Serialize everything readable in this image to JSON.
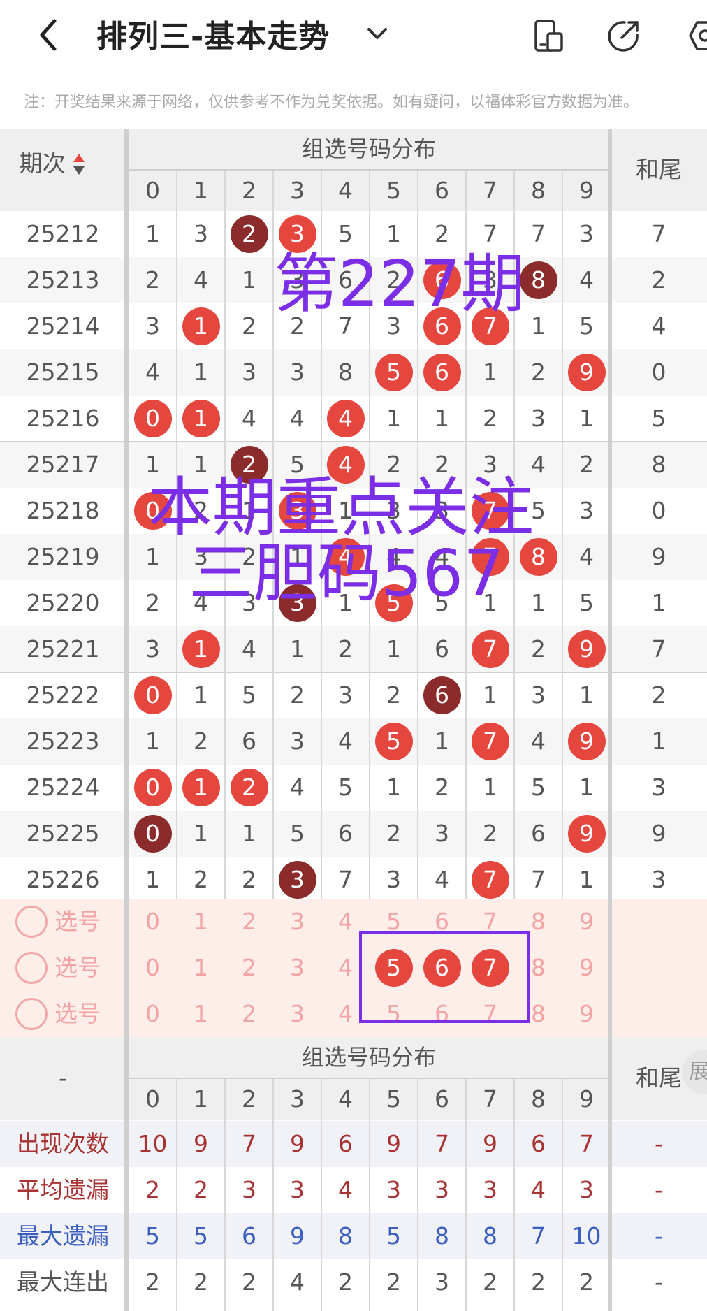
{
  "header": {
    "title": "排列三-基本走势",
    "notice": "注：开奖结果来源于网络，仅供参考不作为兑奖依据。如有疑问，以福体彩官方数据为准。"
  },
  "table": {
    "col_period": "期次",
    "group_title": "组选号码分布",
    "col_sum_tail": "和尾",
    "digits": [
      "0",
      "1",
      "2",
      "3",
      "4",
      "5",
      "6",
      "7",
      "8",
      "9"
    ],
    "rows": [
      {
        "period": "25212",
        "cells": [
          "1",
          "3",
          "2",
          "3",
          "5",
          "1",
          "2",
          "7",
          "7",
          "3"
        ],
        "balls": {
          "2": "dark",
          "3": "red"
        },
        "tail": "7"
      },
      {
        "period": "25213",
        "cells": [
          "2",
          "4",
          "1",
          "3",
          "6",
          "2",
          "6",
          "3",
          "8",
          "4"
        ],
        "balls": {
          "6": "red",
          "8": "dark"
        },
        "tail": "2"
      },
      {
        "period": "25214",
        "cells": [
          "3",
          "1",
          "2",
          "2",
          "7",
          "3",
          "6",
          "7",
          "1",
          "5"
        ],
        "balls": {
          "1": "red",
          "6": "red",
          "7": "red"
        },
        "tail": "4"
      },
      {
        "period": "25215",
        "cells": [
          "4",
          "1",
          "3",
          "3",
          "8",
          "5",
          "6",
          "1",
          "2",
          "9"
        ],
        "balls": {
          "5": "red",
          "6": "red",
          "9": "red"
        },
        "tail": "0"
      },
      {
        "period": "25216",
        "cells": [
          "0",
          "1",
          "4",
          "4",
          "4",
          "1",
          "1",
          "2",
          "3",
          "1"
        ],
        "balls": {
          "0": "red",
          "1": "red",
          "4": "red"
        },
        "tail": "5"
      },
      {
        "period": "25217",
        "cells": [
          "1",
          "1",
          "2",
          "5",
          "4",
          "2",
          "2",
          "3",
          "4",
          "2"
        ],
        "balls": {
          "2": "dark",
          "4": "red"
        },
        "tail": "8"
      },
      {
        "period": "25218",
        "cells": [
          "0",
          "2",
          "1",
          "3",
          "1",
          "3",
          "3",
          "7",
          "5",
          "3"
        ],
        "balls": {
          "0": "red",
          "3": "red",
          "7": "red"
        },
        "tail": "0"
      },
      {
        "period": "25219",
        "cells": [
          "1",
          "3",
          "2",
          "1",
          "4",
          "4",
          "4",
          "7",
          "8",
          "4"
        ],
        "balls": {
          "4": "red",
          "7": "red",
          "8": "red"
        },
        "tail": "9"
      },
      {
        "period": "25220",
        "cells": [
          "2",
          "4",
          "3",
          "3",
          "1",
          "5",
          "5",
          "1",
          "1",
          "5"
        ],
        "balls": {
          "3": "dark",
          "5": "red"
        },
        "tail": "1"
      },
      {
        "period": "25221",
        "cells": [
          "3",
          "1",
          "4",
          "1",
          "2",
          "1",
          "6",
          "7",
          "2",
          "9"
        ],
        "balls": {
          "1": "red",
          "7": "red",
          "9": "red"
        },
        "tail": "7"
      },
      {
        "period": "25222",
        "cells": [
          "0",
          "1",
          "5",
          "2",
          "3",
          "2",
          "6",
          "1",
          "3",
          "1"
        ],
        "balls": {
          "0": "red",
          "6": "dark"
        },
        "tail": "2"
      },
      {
        "period": "25223",
        "cells": [
          "1",
          "2",
          "6",
          "3",
          "4",
          "5",
          "1",
          "7",
          "4",
          "9"
        ],
        "balls": {
          "5": "red",
          "7": "red",
          "9": "red"
        },
        "tail": "1"
      },
      {
        "period": "25224",
        "cells": [
          "0",
          "1",
          "2",
          "4",
          "5",
          "1",
          "2",
          "1",
          "5",
          "1"
        ],
        "balls": {
          "0": "red",
          "1": "red",
          "2": "red"
        },
        "tail": "3"
      },
      {
        "period": "25225",
        "cells": [
          "0",
          "1",
          "1",
          "5",
          "6",
          "2",
          "3",
          "2",
          "6",
          "9"
        ],
        "balls": {
          "0": "dark",
          "9": "red"
        },
        "tail": "9"
      },
      {
        "period": "25226",
        "cells": [
          "1",
          "2",
          "2",
          "3",
          "7",
          "3",
          "4",
          "7",
          "7",
          "1"
        ],
        "balls": {
          "3": "dark",
          "7": "red"
        },
        "tail": "3"
      }
    ],
    "select_label": "选号",
    "select_rows": [
      {
        "selected": []
      },
      {
        "selected": [
          "5",
          "6",
          "7"
        ]
      },
      {
        "selected": []
      }
    ]
  },
  "stats": {
    "col_dash": "-",
    "group_title": "组选号码分布",
    "col_sum_tail": "和尾",
    "expand_label": "展",
    "rows": [
      {
        "label": "出现次数",
        "values": [
          "10",
          "9",
          "7",
          "9",
          "6",
          "9",
          "7",
          "9",
          "6",
          "7"
        ],
        "tail": "-",
        "color": "#a83232"
      },
      {
        "label": "平均遗漏",
        "values": [
          "2",
          "2",
          "3",
          "3",
          "4",
          "3",
          "3",
          "3",
          "4",
          "3"
        ],
        "tail": "-",
        "color": "#a83232"
      },
      {
        "label": "最大遗漏",
        "values": [
          "5",
          "5",
          "6",
          "9",
          "8",
          "5",
          "8",
          "8",
          "7",
          "10"
        ],
        "tail": "-",
        "color": "#3b5fc0"
      },
      {
        "label": "最大连出",
        "values": [
          "2",
          "2",
          "2",
          "4",
          "2",
          "2",
          "3",
          "2",
          "2",
          "2"
        ],
        "tail": "-",
        "color": "#555555"
      }
    ]
  },
  "overlay": {
    "line1": "第227期",
    "line2": "本期重点关注",
    "line3": "三胆码567"
  },
  "colors": {
    "ball_red": "#e5473f",
    "ball_dark": "#8c2b2b",
    "select_bg": "#fdeeea",
    "select_text": "#f2a4a4",
    "overlay": "#7b2ee6"
  }
}
